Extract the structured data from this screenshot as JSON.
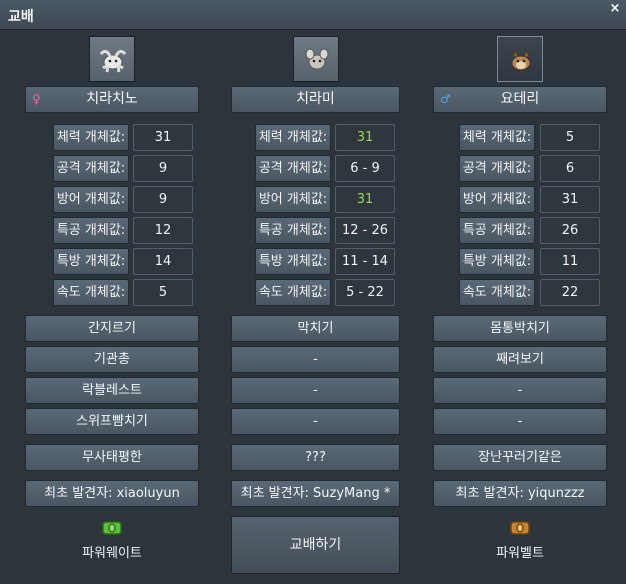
{
  "window": {
    "title": "교배",
    "close_icon": "×"
  },
  "columns": [
    {
      "id": "left",
      "name": "치라치노",
      "gender": "♀",
      "gender_color": "#e86aa0",
      "sprite_icon": "cinccino-sprite-icon",
      "selected": false,
      "stats": [
        {
          "label": "체력 개체값:",
          "value": "31",
          "highlight": false
        },
        {
          "label": "공격 개체값:",
          "value": "9",
          "highlight": false
        },
        {
          "label": "방어 개체값:",
          "value": "9",
          "highlight": false
        },
        {
          "label": "특공 개체값:",
          "value": "12",
          "highlight": false
        },
        {
          "label": "특방 개체값:",
          "value": "14",
          "highlight": false
        },
        {
          "label": "속도 개체값:",
          "value": "5",
          "highlight": false
        }
      ],
      "moves": [
        "간지르기",
        "기관총",
        "락블레스트",
        "스위프뺨치기"
      ],
      "nature": "무사태평한",
      "discoverer": "최초 발견자: xiaoluyun",
      "item": {
        "name": "파워웨이트",
        "icon": "power-weight-icon",
        "color": "#5fbf3a"
      }
    },
    {
      "id": "middle",
      "name": "치라미",
      "gender": "",
      "gender_color": "",
      "sprite_icon": "minccino-sprite-icon",
      "selected": false,
      "stats": [
        {
          "label": "체력 개체값:",
          "value": "31",
          "highlight": true
        },
        {
          "label": "공격 개체값:",
          "value": "6 - 9",
          "highlight": false
        },
        {
          "label": "방어 개체값:",
          "value": "31",
          "highlight": true
        },
        {
          "label": "특공 개체값:",
          "value": "12 - 26",
          "highlight": false
        },
        {
          "label": "특방 개체값:",
          "value": "11 - 14",
          "highlight": false
        },
        {
          "label": "속도 개체값:",
          "value": "5 - 22",
          "highlight": false
        }
      ],
      "moves": [
        "막치기",
        "-",
        "-",
        "-"
      ],
      "nature": "???",
      "discoverer": "최초 발견자: SuzyMang *",
      "trade_button": "교배하기"
    },
    {
      "id": "right",
      "name": "요테리",
      "gender": "♂",
      "gender_color": "#4aa8e8",
      "sprite_icon": "lillipup-sprite-icon",
      "selected": true,
      "stats": [
        {
          "label": "체력 개체값:",
          "value": "5",
          "highlight": false
        },
        {
          "label": "공격 개체값:",
          "value": "6",
          "highlight": false
        },
        {
          "label": "방어 개체값:",
          "value": "31",
          "highlight": false
        },
        {
          "label": "특공 개체값:",
          "value": "26",
          "highlight": false
        },
        {
          "label": "특방 개체값:",
          "value": "11",
          "highlight": false
        },
        {
          "label": "속도 개체값:",
          "value": "22",
          "highlight": false
        }
      ],
      "moves": [
        "몸통박치기",
        "째려보기",
        "-",
        "-"
      ],
      "nature": "장난꾸러기같은",
      "discoverer": "최초 발견자: yiqunzzz",
      "item": {
        "name": "파워벨트",
        "icon": "power-belt-icon",
        "color": "#c9852e"
      }
    }
  ]
}
